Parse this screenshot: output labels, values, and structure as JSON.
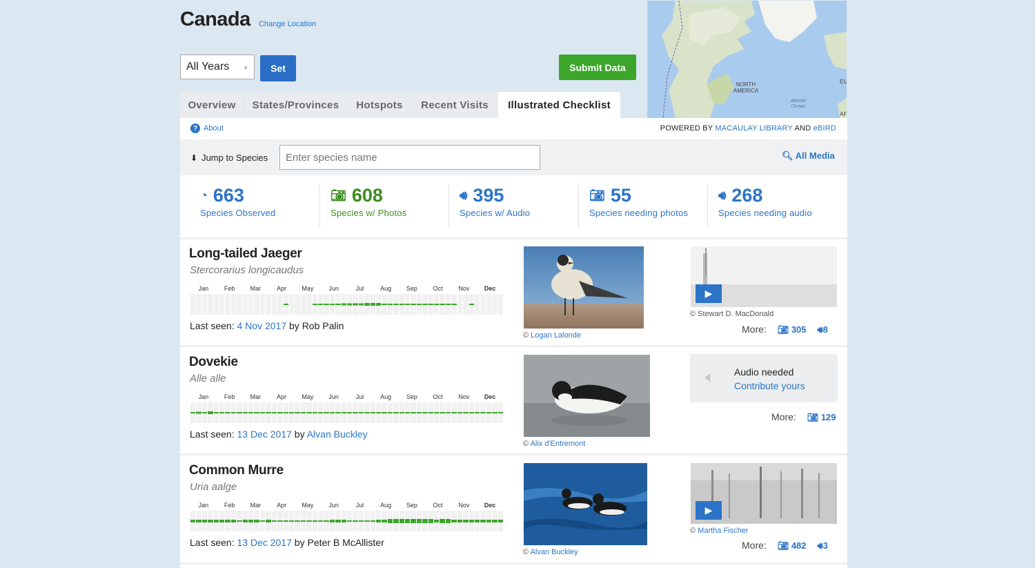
{
  "header": {
    "location": "Canada",
    "change_location": "Change Location",
    "year_select": "All Years",
    "set_label": "Set",
    "submit_label": "Submit Data"
  },
  "map": {
    "labels": [
      "NORTH AMERICA",
      "Atlantic Ocean",
      "EU",
      "AF"
    ]
  },
  "tabs": [
    {
      "label": "Overview"
    },
    {
      "label": "States/Provinces"
    },
    {
      "label": "Hotspots"
    },
    {
      "label": "Recent Visits"
    },
    {
      "label": "Illustrated Checklist",
      "active": true
    }
  ],
  "about": "About",
  "powered": {
    "prefix": "POWERED BY",
    "macaulay": "MACAULAY LIBRARY",
    "and": "AND",
    "ebird": "eBIRD"
  },
  "jump": {
    "label": "Jump to Species",
    "placeholder": "Enter species name",
    "all_media": "All Media"
  },
  "stats": [
    {
      "value": "663",
      "label": "Species Observed",
      "icon": "observed-icon",
      "color": "#2b74c7"
    },
    {
      "value": "608",
      "label": "Species w/ Photos",
      "icon": "camera-icon",
      "color": "#3a8d1c"
    },
    {
      "value": "395",
      "label": "Species w/ Audio",
      "icon": "speaker-icon",
      "color": "#2b74c7"
    },
    {
      "value": "55",
      "label": "Species needing photos",
      "icon": "camera-needed-icon",
      "color": "#2b74c7"
    },
    {
      "value": "268",
      "label": "Species needing audio",
      "icon": "speaker-needed-icon",
      "color": "#2b74c7"
    }
  ],
  "months": [
    "Jan",
    "Feb",
    "Mar",
    "Apr",
    "May",
    "Jun",
    "Jul",
    "Aug",
    "Sep",
    "Oct",
    "Nov",
    "Dec"
  ],
  "species": [
    {
      "name": "Long-tailed Jaeger",
      "scientific": "Stercorarius longicaudus",
      "freq": [
        0,
        0,
        0,
        0,
        0,
        0,
        0,
        0,
        0,
        0,
        0,
        0,
        0,
        0,
        0,
        0,
        2,
        0,
        0,
        0,
        0,
        2,
        2,
        2,
        2,
        2,
        3,
        3,
        3,
        3,
        4,
        4,
        4,
        2,
        2,
        2,
        2,
        2,
        2,
        2,
        2,
        2,
        2,
        2,
        2,
        2,
        0,
        0,
        2,
        0,
        0,
        0,
        0,
        0
      ],
      "last_seen_label": "Last seen:",
      "last_seen_date": "4 Nov 2017",
      "by_label": "by",
      "observer": "Rob Palin",
      "observer_link": false,
      "photo_credit": "Logan Lalonde",
      "audio_credit": "Stewart D. MacDonald",
      "audio_credit_link": false,
      "more_label": "More:",
      "photos_count": "305",
      "audio_count": "8"
    },
    {
      "name": "Dovekie",
      "scientific": "Alle alle",
      "freq": [
        2,
        3,
        2,
        4,
        2,
        2,
        2,
        2,
        2,
        2,
        2,
        2,
        2,
        2,
        2,
        2,
        2,
        2,
        2,
        2,
        2,
        2,
        2,
        2,
        2,
        2,
        2,
        2,
        2,
        2,
        2,
        2,
        2,
        2,
        2,
        2,
        2,
        2,
        2,
        2,
        2,
        2,
        2,
        2,
        2,
        2,
        2,
        2,
        2,
        2,
        2,
        2,
        2,
        2
      ],
      "last_seen_label": "Last seen:",
      "last_seen_date": "13 Dec 2017",
      "by_label": "by",
      "observer": "Alvan Buckley",
      "observer_link": true,
      "photo_credit": "Alix d'Entremont",
      "audio_needed": "Audio needed",
      "contribute": "Contribute yours",
      "more_label": "More:",
      "photos_count": "129"
    },
    {
      "name": "Common Murre",
      "scientific": "Uria aalge",
      "freq": [
        4,
        4,
        4,
        4,
        4,
        4,
        4,
        4,
        2,
        4,
        4,
        4,
        2,
        4,
        2,
        2,
        2,
        2,
        2,
        2,
        2,
        2,
        2,
        2,
        4,
        4,
        4,
        2,
        2,
        2,
        2,
        2,
        4,
        4,
        6,
        6,
        6,
        6,
        6,
        6,
        6,
        6,
        4,
        6,
        6,
        4,
        4,
        4,
        4,
        4,
        4,
        4,
        4,
        4
      ],
      "last_seen_label": "Last seen:",
      "last_seen_date": "13 Dec 2017",
      "by_label": "by",
      "observer": "Peter B McAllister",
      "observer_link": false,
      "photo_credit": "Alvan Buckley",
      "audio_credit": "Martha Fischer",
      "audio_credit_link": true,
      "more_label": "More:",
      "photos_count": "482",
      "audio_count": "3"
    }
  ]
}
